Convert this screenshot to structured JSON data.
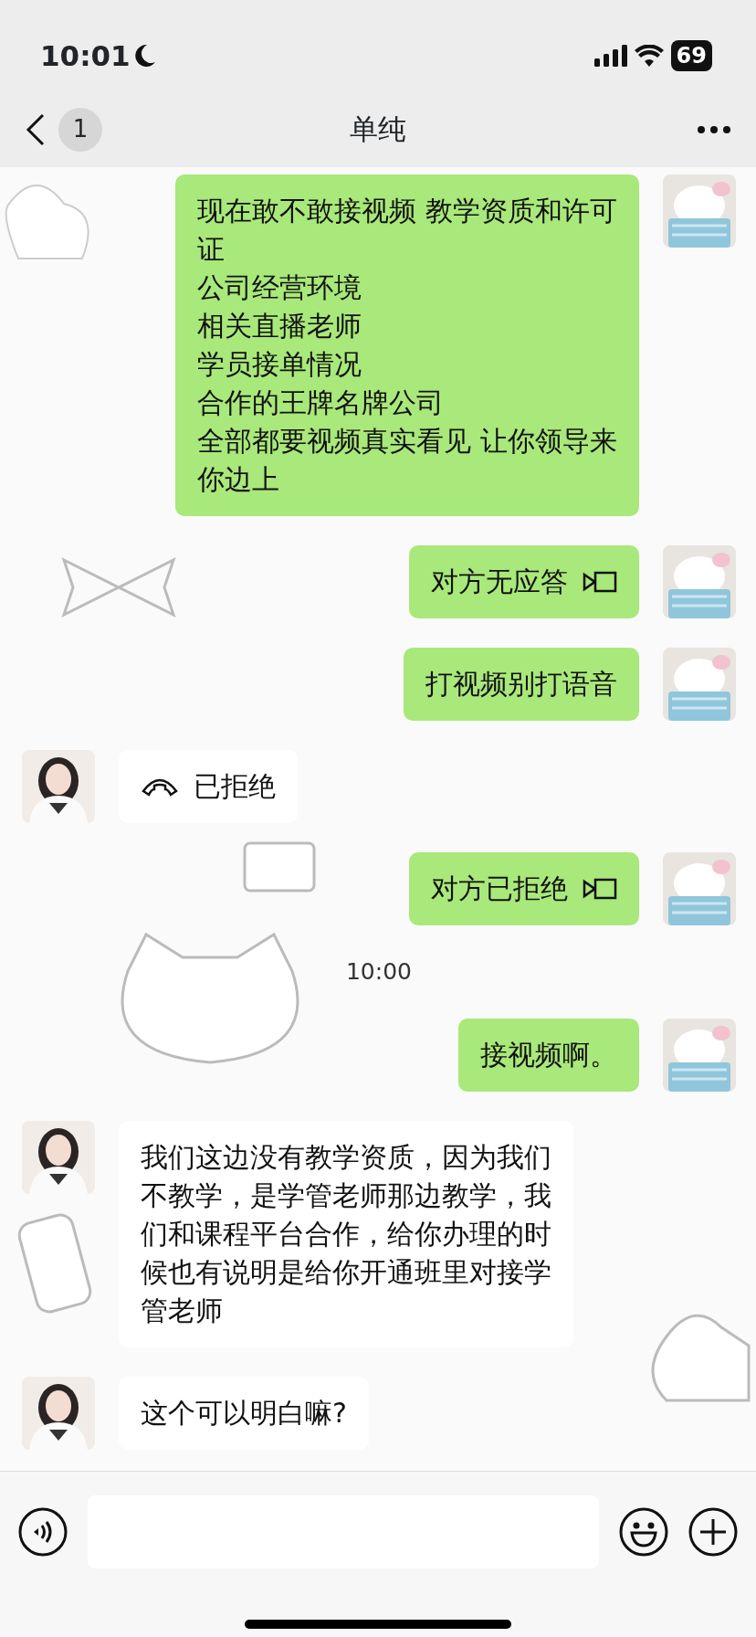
{
  "status_bar": {
    "time": "10:01",
    "battery": "69"
  },
  "header": {
    "unread": "1",
    "title": "单纯"
  },
  "messages": [
    {
      "kind": "text",
      "outgoing": true,
      "lines": [
        "现在敢不敢接视频 教学资质和许可",
        "证",
        "公司经营环境",
        "相关直播老师",
        "学员接单情况",
        "合作的王牌名牌公司",
        "全部都要视频真实看见 让你领导来",
        "你边上"
      ]
    },
    {
      "kind": "video_call",
      "outgoing": true,
      "text": "对方无应答"
    },
    {
      "kind": "text",
      "outgoing": true,
      "lines": [
        "打视频别打语音"
      ]
    },
    {
      "kind": "voice_call",
      "outgoing": false,
      "text": "已拒绝"
    },
    {
      "kind": "video_call",
      "outgoing": true,
      "text": "对方已拒绝"
    },
    {
      "kind": "time",
      "text": "10:00"
    },
    {
      "kind": "text",
      "outgoing": true,
      "lines": [
        "接视频啊。"
      ]
    },
    {
      "kind": "text",
      "outgoing": false,
      "lines": [
        "我们这边没有教学资质，因为我们",
        "不教学，是学管老师那边教学，我",
        "们和课程平台合作，给你办理的时",
        "候也有说明是给你开通班里对接学",
        "管老师"
      ]
    },
    {
      "kind": "text",
      "outgoing": false,
      "lines": [
        "这个可以明白嘛?"
      ]
    }
  ]
}
